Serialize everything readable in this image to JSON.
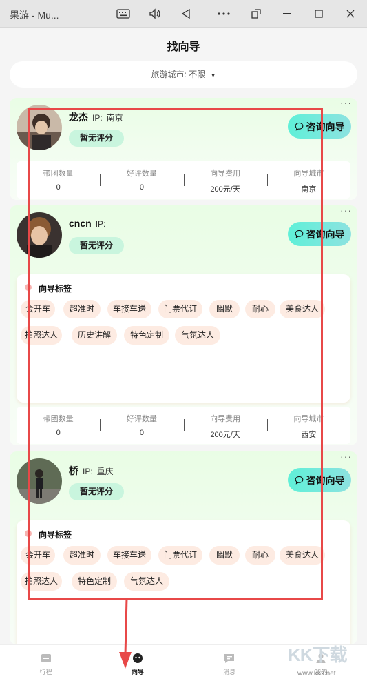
{
  "window": {
    "title": "果游 - Mu..."
  },
  "header": {
    "title": "找向导"
  },
  "filter": {
    "label": "旅游城市:",
    "value": "不限"
  },
  "stat_labels": {
    "tours": "带团数量",
    "reviews": "好评数量",
    "fee": "向导费用",
    "city": "向导城市"
  },
  "tags_title": "向导标签",
  "guides": [
    {
      "name": "龙杰",
      "ip_label": "IP:",
      "ip": "南京",
      "rating": "暂无评分",
      "consult": "咨询向导",
      "stats": {
        "tours": "0",
        "reviews": "0",
        "fee": "200元/天",
        "city": "南京"
      }
    },
    {
      "name": "cncn",
      "ip_label": "IP:",
      "ip": "",
      "rating": "暂无评分",
      "consult": "咨询向导",
      "tags": [
        "会开车",
        "超准时",
        "车接车送",
        "门票代订",
        "幽默",
        "耐心",
        "美食达人",
        "拍照达人",
        "历史讲解",
        "特色定制",
        "气氛达人"
      ],
      "stats": {
        "tours": "0",
        "reviews": "0",
        "fee": "200元/天",
        "city": "西安"
      }
    },
    {
      "name": "桥",
      "ip_label": "IP:",
      "ip": "重庆",
      "rating": "暂无评分",
      "consult": "咨询向导",
      "tags": [
        "会开车",
        "超准时",
        "车接车送",
        "门票代订",
        "幽默",
        "耐心",
        "美食达人",
        "拍照达人",
        "特色定制",
        "气氛达人"
      ]
    }
  ],
  "tabbar": {
    "items": [
      {
        "label": "行程",
        "icon": "itinerary-icon"
      },
      {
        "label": "向导",
        "icon": "guide-icon"
      },
      {
        "label": "消息",
        "icon": "message-icon"
      },
      {
        "label": "我的",
        "icon": "profile-icon"
      }
    ],
    "active": "向导"
  },
  "watermark": {
    "text": "KK下载",
    "url": "www.kkx.net"
  },
  "colors": {
    "accent_button": "#5ff0d8",
    "rating_bg": "#c9f5de",
    "tag_bg": "#fdebe2",
    "annotation": "#e84848"
  }
}
